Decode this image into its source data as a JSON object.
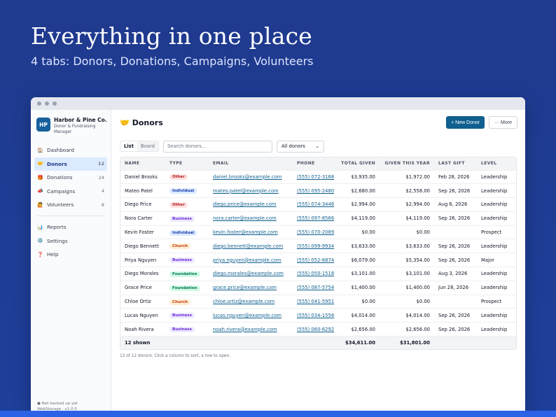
{
  "hero": {
    "title": "Everything in one place",
    "subtitle": "4 tabs: Donors, Donations, Campaigns, Volunteers"
  },
  "brand": {
    "initials": "HP",
    "name": "Harbor & Pine Co.",
    "role": "Donor & Fundraising Manager"
  },
  "sidebar": {
    "items": [
      {
        "icon": "🏠",
        "label": "Dashboard",
        "count": ""
      },
      {
        "icon": "🤝",
        "label": "Donors",
        "count": "12"
      },
      {
        "icon": "🎁",
        "label": "Donations",
        "count": "24"
      },
      {
        "icon": "📣",
        "label": "Campaigns",
        "count": "4"
      },
      {
        "icon": "🙋",
        "label": "Volunteers",
        "count": "8"
      },
      {
        "icon": "📊",
        "label": "Reports",
        "count": ""
      },
      {
        "icon": "⚙️",
        "label": "Settings",
        "count": ""
      },
      {
        "icon": "❓",
        "label": "Help",
        "count": ""
      }
    ],
    "footer_line1": "● Not backed up yet",
    "footer_line2": "WebStorage · v1.0.0"
  },
  "main": {
    "title_icon": "🤝",
    "title": "Donors",
    "new_button": "+ New Donor",
    "more_button": "··· More",
    "view_tabs": [
      "List",
      "Board"
    ],
    "search_placeholder": "Search donors...",
    "filter_value": "All donors",
    "hint": "12 of 12 donors. Click a column to sort, a row to open."
  },
  "table": {
    "headers": [
      "NAME",
      "TYPE",
      "EMAIL",
      "PHONE",
      "TOTAL GIVEN",
      "GIVEN THIS YEAR",
      "LAST GIFT",
      "LEVEL"
    ],
    "rows": [
      {
        "name": "Daniel Brooks",
        "type": "Other",
        "email": "daniel.brooks@example.com",
        "phone": "(555) 072-3168",
        "total": "$3,935.00",
        "year": "$1,972.00",
        "last": "Feb 28, 2026",
        "level": "Leadership"
      },
      {
        "name": "Mateo Patel",
        "type": "Individual",
        "email": "mateo.patel@example.com",
        "phone": "(555) 095-2480",
        "total": "$2,680.00",
        "year": "$2,558.00",
        "last": "Sep 26, 2026",
        "level": "Leadership"
      },
      {
        "name": "Diego Price",
        "type": "Other",
        "email": "diego.price@example.com",
        "phone": "(555) 074-3446",
        "total": "$2,994.00",
        "year": "$2,994.00",
        "last": "Aug 6, 2026",
        "level": "Leadership"
      },
      {
        "name": "Nora Carter",
        "type": "Business",
        "email": "nora.carter@example.com",
        "phone": "(555) 097-8566",
        "total": "$4,119.00",
        "year": "$4,119.00",
        "last": "Sep 26, 2026",
        "level": "Leadership"
      },
      {
        "name": "Kevin Foster",
        "type": "Individual",
        "email": "kevin.foster@example.com",
        "phone": "(555) 070-2089",
        "total": "$0.00",
        "year": "$0.00",
        "last": "",
        "level": "Prospect"
      },
      {
        "name": "Diego Bennett",
        "type": "Church",
        "email": "diego.bennett@example.com",
        "phone": "(555) 099-9934",
        "total": "$3,633.00",
        "year": "$3,633.00",
        "last": "Sep 26, 2026",
        "level": "Leadership"
      },
      {
        "name": "Priya Nguyen",
        "type": "Business",
        "email": "priya.nguyen@example.com",
        "phone": "(555) 052-6874",
        "total": "$6,079.00",
        "year": "$5,354.00",
        "last": "Sep 26, 2026",
        "level": "Major"
      },
      {
        "name": "Diego Morales",
        "type": "Foundation",
        "email": "diego.morales@example.com",
        "phone": "(555) 050-1518",
        "total": "$3,101.00",
        "year": "$3,101.00",
        "last": "Aug 3, 2026",
        "level": "Leadership"
      },
      {
        "name": "Grace Price",
        "type": "Foundation",
        "email": "grace.price@example.com",
        "phone": "(555) 087-5754",
        "total": "$1,400.00",
        "year": "$1,400.00",
        "last": "Jun 28, 2026",
        "level": "Leadership"
      },
      {
        "name": "Chloe Ortiz",
        "type": "Church",
        "email": "chloe.ortiz@example.com",
        "phone": "(555) 041-5951",
        "total": "$0.00",
        "year": "$0.00",
        "last": "",
        "level": "Prospect"
      },
      {
        "name": "Lucas Nguyen",
        "type": "Business",
        "email": "lucas.nguyen@example.com",
        "phone": "(555) 034-1556",
        "total": "$4,014.00",
        "year": "$4,014.00",
        "last": "Sep 26, 2026",
        "level": "Leadership"
      },
      {
        "name": "Noah Rivera",
        "type": "Business",
        "email": "noah.rivera@example.com",
        "phone": "(555) 060-6292",
        "total": "$2,656.00",
        "year": "$2,656.00",
        "last": "Sep 26, 2026",
        "level": "Leadership"
      }
    ],
    "footer": {
      "shown": "12 shown",
      "total": "$34,611.00",
      "year": "$31,801.00"
    }
  },
  "badge_colors": {
    "Other": {
      "bg": "#fde2e2",
      "fg": "#b91c1c"
    },
    "Individual": {
      "bg": "#dbeafe",
      "fg": "#1e40af"
    },
    "Business": {
      "bg": "#ede9fe",
      "fg": "#6d28d9"
    },
    "Church": {
      "bg": "#ffedd5",
      "fg": "#c2410c"
    },
    "Foundation": {
      "bg": "#d1fae5",
      "fg": "#047857"
    }
  }
}
